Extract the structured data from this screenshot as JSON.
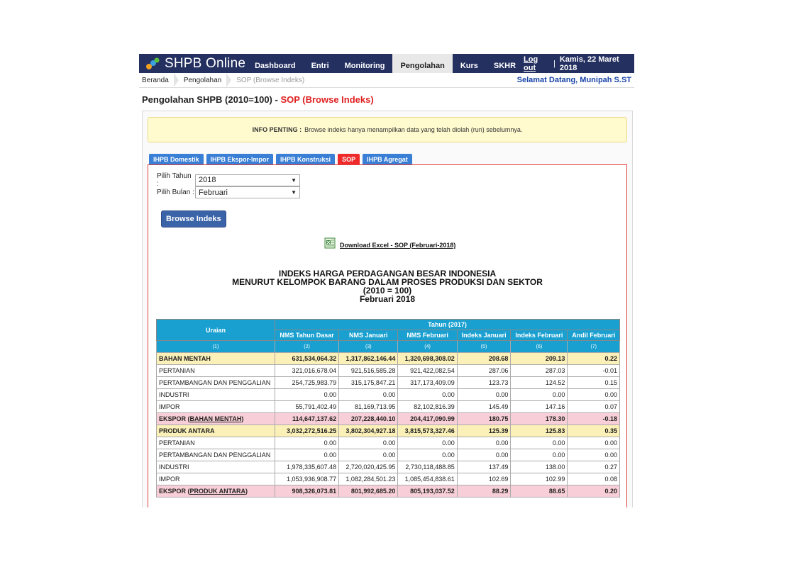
{
  "app": {
    "logo_text": "SHPB Online",
    "nav": [
      "Dashboard",
      "Entri",
      "Monitoring",
      "Pengolahan",
      "Kurs",
      "SKHR"
    ],
    "active_nav": "Pengolahan",
    "logout": "Log out",
    "sep": "|",
    "date": "Kamis, 22 Maret 2018",
    "welcome": "Selamat Datang, Munipah S.ST"
  },
  "breadcrumb": [
    "Beranda",
    "Pengolahan",
    "SOP (Browse Indeks)"
  ],
  "page_title": {
    "main": "Pengolahan SHPB (2010=100) - ",
    "accent": "SOP (Browse Indeks)"
  },
  "info": {
    "label": "INFO PENTING :",
    "text": "Browse indeks hanya menampilkan data yang telah diolah (run) sebelumnya."
  },
  "tabs": [
    "IHPB Domestik",
    "IHPB Ekspor-Impor",
    "IHPB Konstruksi",
    "SOP",
    "IHPB Agregat"
  ],
  "active_tab": "SOP",
  "form": {
    "tahun_label": "Pilih Tahun :",
    "tahun_value": "2018",
    "bulan_label": "Pilih Bulan :",
    "bulan_value": "Februari",
    "browse_button": "Browse Indeks"
  },
  "download_link": "Download Excel - SOP (Februari-2018)",
  "report_title": [
    "INDEKS HARGA PERDAGANGAN BESAR INDONESIA",
    "MENURUT KELOMPOK BARANG DALAM PROSES PRODUKSI DAN SEKTOR",
    "(2010 = 100)",
    "Februari 2018"
  ],
  "table": {
    "uraian": "Uraian",
    "group_header": "Tahun (2017)",
    "columns": [
      "NMS Tahun Dasar",
      "NMS Januari",
      "NMS Februari",
      "Indeks Januari",
      "Indeks Februari",
      "Andil Februari"
    ],
    "numbers": [
      "(1)",
      "(2)",
      "(3)",
      "(4)",
      "(5)",
      "(6)",
      "(7)"
    ],
    "rows": [
      {
        "type": "grp",
        "cells": [
          "BAHAN MENTAH",
          "631,534,064.32",
          "1,317,862,146.44",
          "1,320,698,308.02",
          "208.68",
          "209.13",
          "0.22"
        ]
      },
      {
        "type": "",
        "cells": [
          "PERTANIAN",
          "321,016,678.04",
          "921,516,585.28",
          "921,422,082.54",
          "287.06",
          "287.03",
          "-0.01"
        ]
      },
      {
        "type": "",
        "cells": [
          "PERTAMBANGAN DAN PENGGALIAN",
          "254,725,983.79",
          "315,175,847.21",
          "317,173,409.09",
          "123.73",
          "124.52",
          "0.15"
        ]
      },
      {
        "type": "",
        "cells": [
          "INDUSTRI",
          "0.00",
          "0.00",
          "0.00",
          "0.00",
          "0.00",
          "0.00"
        ]
      },
      {
        "type": "",
        "cells": [
          "IMPOR",
          "55,791,402.49",
          "81,169,713.95",
          "82,102,816.39",
          "145.49",
          "147.16",
          "0.07"
        ]
      },
      {
        "type": "eks",
        "prefix": "EKSPOR (",
        "link": "BAHAN MENTAH",
        "suffix": ")",
        "cells": [
          "EKSPOR (BAHAN MENTAH)",
          "114,647,137.62",
          "207,228,440.10",
          "204,417,090.99",
          "180.75",
          "178.30",
          "-0.18"
        ]
      },
      {
        "type": "grp",
        "cells": [
          "PRODUK ANTARA",
          "3,032,272,516.25",
          "3,802,304,927.18",
          "3,815,573,327.46",
          "125.39",
          "125.83",
          "0.35"
        ]
      },
      {
        "type": "",
        "cells": [
          "PERTANIAN",
          "0.00",
          "0.00",
          "0.00",
          "0.00",
          "0.00",
          "0.00"
        ]
      },
      {
        "type": "",
        "cells": [
          "PERTAMBANGAN DAN PENGGALIAN",
          "0.00",
          "0.00",
          "0.00",
          "0.00",
          "0.00",
          "0.00"
        ]
      },
      {
        "type": "",
        "cells": [
          "INDUSTRI",
          "1,978,335,607.48",
          "2,720,020,425.95",
          "2,730,118,488.85",
          "137.49",
          "138.00",
          "0.27"
        ]
      },
      {
        "type": "",
        "cells": [
          "IMPOR",
          "1,053,936,908.77",
          "1,082,284,501.23",
          "1,085,454,838.61",
          "102.69",
          "102.99",
          "0.08"
        ]
      },
      {
        "type": "eks",
        "prefix": "EKSPOR (",
        "link": "PRODUK ANTARA",
        "suffix": ")",
        "cells": [
          "EKSPOR (PRODUK ANTARA)",
          "908,326,073.81",
          "801,992,685.20",
          "805,193,037.52",
          "88.29",
          "88.65",
          "0.20"
        ]
      }
    ]
  }
}
